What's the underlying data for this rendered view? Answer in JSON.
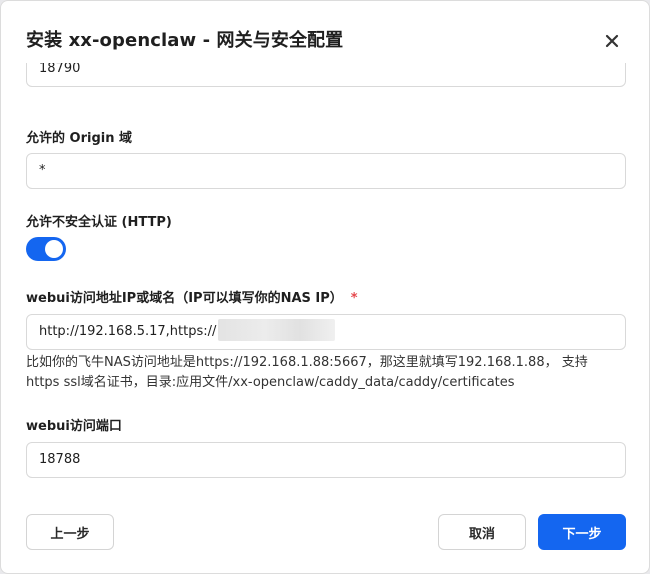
{
  "dialog": {
    "title": "安装 xx-openclaw - 网关与安全配置"
  },
  "fields": {
    "port": {
      "value": "18790"
    },
    "origin": {
      "label": "允许的 Origin 域",
      "value": "*"
    },
    "insecure_auth": {
      "label": "允许不安全认证 (HTTP)",
      "enabled": true
    },
    "webui_address": {
      "label": "webui访问地址IP或域名（IP可以填写你的NAS IP）",
      "required_mark": "*",
      "value": "http://192.168.5.17,https://",
      "hint_line1": "比如你的飞牛NAS访问地址是https://192.168.1.88:5667，那这里就填写192.168.1.88， 支持",
      "hint_line2": "https ssl域名证书，目录:应用文件/xx-openclaw/caddy_data/caddy/certificates"
    },
    "webui_port": {
      "label": "webui访问端口",
      "value": "18788"
    }
  },
  "footer": {
    "prev_label": "上一步",
    "cancel_label": "取消",
    "next_label": "下一步"
  },
  "colors": {
    "primary": "#1466f0",
    "required": "#e5484d"
  },
  "icons": {
    "close": "close-icon"
  }
}
